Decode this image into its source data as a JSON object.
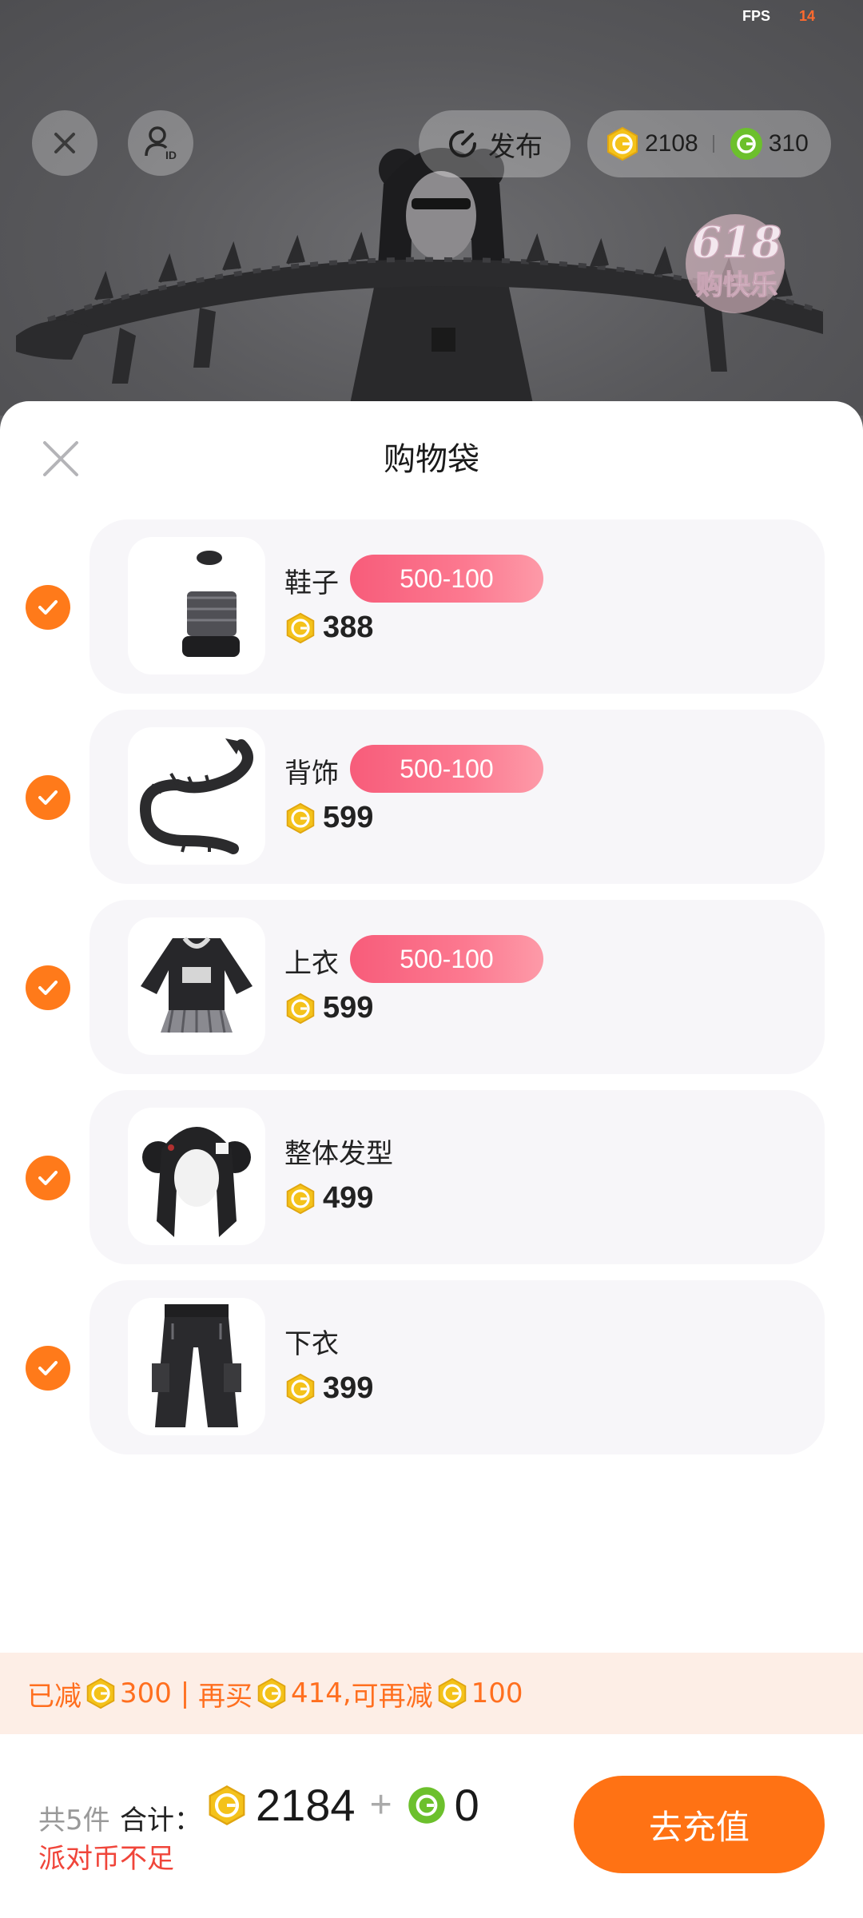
{
  "status": {
    "fps_label": "FPS",
    "fps_value": "14"
  },
  "top_bar": {
    "publish_label": "发布",
    "gold_coins": "2108",
    "green_coins": "310"
  },
  "promo_badge": {
    "line1": "618",
    "line2": "购快乐"
  },
  "sheet": {
    "title": "购物袋",
    "items": [
      {
        "name": "鞋子",
        "promo": "500-100",
        "price": "388"
      },
      {
        "name": "背饰",
        "promo": "500-100",
        "price": "599"
      },
      {
        "name": "上衣",
        "promo": "500-100",
        "price": "599"
      },
      {
        "name": "整体发型",
        "promo": "",
        "price": "499"
      },
      {
        "name": "下衣",
        "promo": "",
        "price": "399"
      }
    ]
  },
  "discount": {
    "reduced_label": "已减",
    "reduced_amount": "300 | ",
    "buy_more_label": "再买",
    "buy_more_amount": "414,",
    "further_label": "可再减",
    "further_amount": "100"
  },
  "footer": {
    "count_label": "共5件",
    "total_label": "合计：",
    "gold_total": "2184",
    "plus": "+",
    "green_total": "0",
    "insufficient_label": "派对币不足",
    "recharge_label": "去充值"
  },
  "colors": {
    "accent_orange": "#ff7214",
    "promo_pink": "#f75c7a",
    "warning_red": "#f0453a",
    "gold_coin": "#f4c21a",
    "green_coin": "#6cc02c"
  }
}
